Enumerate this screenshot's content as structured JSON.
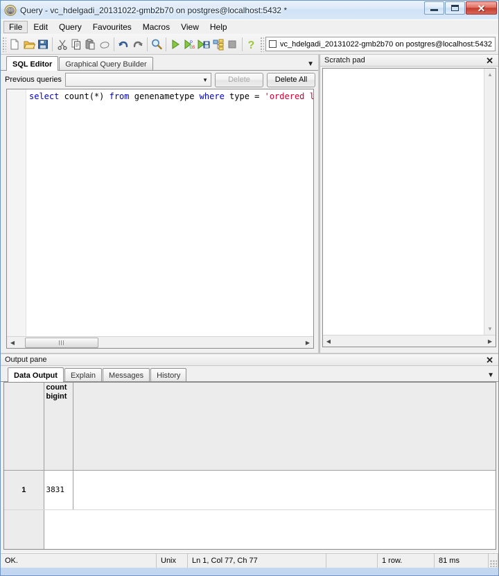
{
  "window": {
    "title": "Query - vc_hdelgadi_20131022-gmb2b70 on postgres@localhost:5432 *",
    "app_icon": "pgadmin-elephant-icon",
    "buttons": {
      "minimize": "minimize-button",
      "maximize": "maximize-button",
      "close": "close-button"
    }
  },
  "menubar": {
    "items": [
      {
        "label": "File",
        "focused": true
      },
      {
        "label": "Edit",
        "focused": false
      },
      {
        "label": "Query",
        "focused": false
      },
      {
        "label": "Favourites",
        "focused": false
      },
      {
        "label": "Macros",
        "focused": false
      },
      {
        "label": "View",
        "focused": false
      },
      {
        "label": "Help",
        "focused": false
      }
    ]
  },
  "toolbar": {
    "buttons": [
      {
        "name": "new-file-icon",
        "tooltip": "New"
      },
      {
        "name": "open-folder-icon",
        "tooltip": "Open file"
      },
      {
        "name": "save-icon",
        "tooltip": "Save"
      },
      {
        "name": "cut-scissors-icon",
        "tooltip": "Cut"
      },
      {
        "name": "copy-icon",
        "tooltip": "Copy"
      },
      {
        "name": "paste-icon",
        "tooltip": "Paste"
      },
      {
        "name": "eraser-icon",
        "tooltip": "Clear window"
      },
      {
        "name": "undo-arrow-icon",
        "tooltip": "Undo"
      },
      {
        "name": "redo-arrow-icon",
        "tooltip": "Redo"
      },
      {
        "name": "find-magnifier-icon",
        "tooltip": "Find"
      },
      {
        "name": "execute-play-icon",
        "tooltip": "Execute query"
      },
      {
        "name": "explain-pgs-icon",
        "tooltip": "Execute pgScript"
      },
      {
        "name": "execute-to-file-icon",
        "tooltip": "Execute to file"
      },
      {
        "name": "explain-plan-icon",
        "tooltip": "Explain query"
      },
      {
        "name": "stop-icon",
        "tooltip": "Cancel query"
      },
      {
        "name": "help-question-icon",
        "tooltip": "Help"
      }
    ],
    "connection": {
      "checkbox_checked": false,
      "label": "vc_hdelgadi_20131022-gmb2b70 on postgres@localhost:5432"
    }
  },
  "editor": {
    "tabs": [
      {
        "label": "SQL Editor",
        "active": true
      },
      {
        "label": "Graphical Query Builder",
        "active": false
      }
    ],
    "tab_overflow_icon": "chevron-down-icon",
    "previous_queries": {
      "label": "Previous queries",
      "value": "",
      "placeholder": "",
      "dropdown_icon": "chevron-down-icon"
    },
    "delete_button": {
      "label": "Delete",
      "disabled": true
    },
    "delete_all_button": {
      "label": "Delete All",
      "disabled": false
    },
    "sql": {
      "segments": [
        {
          "text": "select",
          "kind": "keyword"
        },
        {
          "text": " count(*) ",
          "kind": "plain"
        },
        {
          "text": "from",
          "kind": "keyword"
        },
        {
          "text": " genenametype ",
          "kind": "plain"
        },
        {
          "text": "where",
          "kind": "keyword"
        },
        {
          "text": " type = ",
          "kind": "plain"
        },
        {
          "text": "'ordered lo",
          "kind": "string"
        }
      ],
      "full_text": "select count(*) from genenametype where type = 'ordered lo"
    },
    "scroll": {
      "left_arrow_icon": "triangle-left-icon",
      "right_arrow_icon": "triangle-right-icon"
    },
    "colors": {
      "keyword": "#0000c0",
      "string": "#cc0033",
      "plain": "#000000"
    }
  },
  "scratchpad": {
    "caption": "Scratch pad",
    "close_icon": "close-x-icon",
    "content": "",
    "scroll": {
      "up_arrow_icon": "triangle-up-icon",
      "down_arrow_icon": "triangle-down-icon",
      "left_arrow_icon": "triangle-left-icon",
      "right_arrow_icon": "triangle-right-icon"
    }
  },
  "output_pane": {
    "caption": "Output pane",
    "close_icon": "close-x-icon",
    "tab_overflow_icon": "chevron-down-icon",
    "tabs": [
      {
        "label": "Data Output",
        "active": true
      },
      {
        "label": "Explain",
        "active": false
      },
      {
        "label": "Messages",
        "active": false
      },
      {
        "label": "History",
        "active": false
      }
    ],
    "grid": {
      "columns": [
        {
          "name": "count",
          "type": "bigint"
        }
      ],
      "rows": [
        {
          "num": "1",
          "values": [
            "3831"
          ]
        }
      ]
    }
  },
  "statusbar": {
    "message": "OK.",
    "line_ending": "Unix",
    "position": "Ln 1, Col 77, Ch 77",
    "spacer": "",
    "rows": "1 row.",
    "duration": "81 ms"
  }
}
